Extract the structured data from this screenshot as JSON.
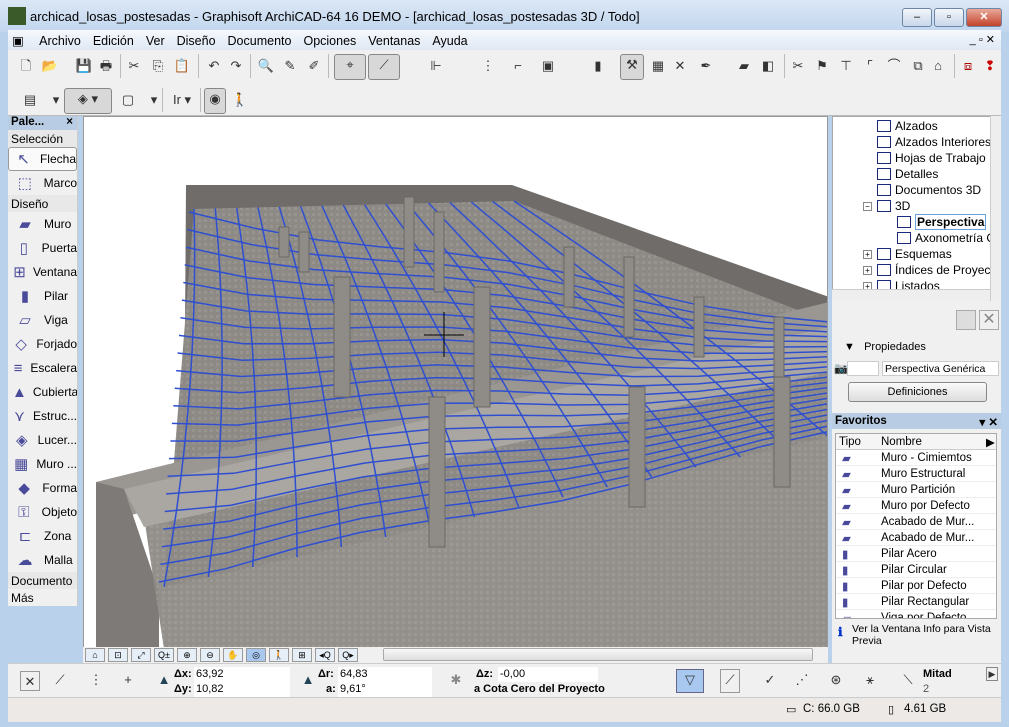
{
  "window": {
    "title": "archicad_losas_postesadas - Graphisoft ArchiCAD-64 16 DEMO - [archicad_losas_postesadas 3D / Todo]",
    "minimize": "–",
    "maximize": "▫",
    "close": "✕"
  },
  "menu": [
    "Archivo",
    "Edición",
    "Ver",
    "Diseño",
    "Documento",
    "Opciones",
    "Ventanas",
    "Ayuda"
  ],
  "toolbar2": {
    "ir_label": "Ir"
  },
  "palette": {
    "title": "Pale...",
    "close": "×",
    "sections": {
      "seleccion": "Selección",
      "diseno": "Diseño",
      "documento": "Documento",
      "mas": "Más"
    },
    "selection_tools": [
      {
        "label": "Flecha",
        "icon": "arrow-icon"
      },
      {
        "label": "Marco",
        "icon": "marquee-icon"
      }
    ],
    "design_tools": [
      {
        "label": "Muro",
        "icon": "wall-icon"
      },
      {
        "label": "Puerta",
        "icon": "door-icon"
      },
      {
        "label": "Ventana",
        "icon": "window-icon"
      },
      {
        "label": "Pilar",
        "icon": "column-icon"
      },
      {
        "label": "Viga",
        "icon": "beam-icon"
      },
      {
        "label": "Forjado",
        "icon": "slab-icon"
      },
      {
        "label": "Escalera",
        "icon": "stair-icon"
      },
      {
        "label": "Cubierta",
        "icon": "roof-icon"
      },
      {
        "label": "Estruc...",
        "icon": "shell-icon"
      },
      {
        "label": "Lucer...",
        "icon": "skylight-icon"
      },
      {
        "label": "Muro ...",
        "icon": "curtain-wall-icon"
      },
      {
        "label": "Forma",
        "icon": "morph-icon"
      },
      {
        "label": "Objeto",
        "icon": "object-icon"
      },
      {
        "label": "Zona",
        "icon": "zone-icon"
      },
      {
        "label": "Malla",
        "icon": "mesh-icon"
      }
    ]
  },
  "navigator": {
    "items": [
      {
        "label": "Alzados"
      },
      {
        "label": "Alzados Interiores"
      },
      {
        "label": "Hojas de Trabajo"
      },
      {
        "label": "Detalles"
      },
      {
        "label": "Documentos 3D"
      },
      {
        "label": "3D"
      },
      {
        "label": "Perspectiva"
      },
      {
        "label": "Axonometría G"
      },
      {
        "label": "Esquemas"
      },
      {
        "label": "Índices de Proyecto"
      },
      {
        "label": "Listados"
      }
    ],
    "selected": "Perspectiva"
  },
  "properties": {
    "header": "Propiedades",
    "view_id": "",
    "view_name": "Perspectiva Genérica",
    "definitions_button": "Definiciones"
  },
  "favoritos": {
    "title": "Favoritos",
    "col_tipo": "Tipo",
    "col_nombre": "Nombre",
    "items": [
      "Muro - Cimiemtos",
      "Muro Estructural",
      "Muro Partición",
      "Muro por Defecto",
      "Acabado de Mur...",
      "Acabado de Mur...",
      "Pilar Acero",
      "Pilar Circular",
      "Pilar por Defecto",
      "Pilar Rectangular",
      "Viga por Defecto"
    ],
    "info": "Ver la Ventana Info para Vista Previa"
  },
  "infobox": {
    "dx_label": "Δx:",
    "dx": "63,92",
    "dy_label": "Δy:",
    "dy": "10,82",
    "dr_label": "Δr:",
    "dr": "64,83",
    "a_label": "a:",
    "a": "9,61°",
    "dz_label": "Δz:",
    "dz": "-0,00",
    "ref": "a Cota Cero del Proyecto",
    "mitad": "Mitad",
    "mitad_n": "2"
  },
  "status": {
    "disk": "C: 66.0 GB",
    "memory": "4.61 GB"
  },
  "colors": {
    "accent": "#3a5fcf",
    "tendon": "#2f4fd0",
    "concrete": "#8a8784"
  }
}
